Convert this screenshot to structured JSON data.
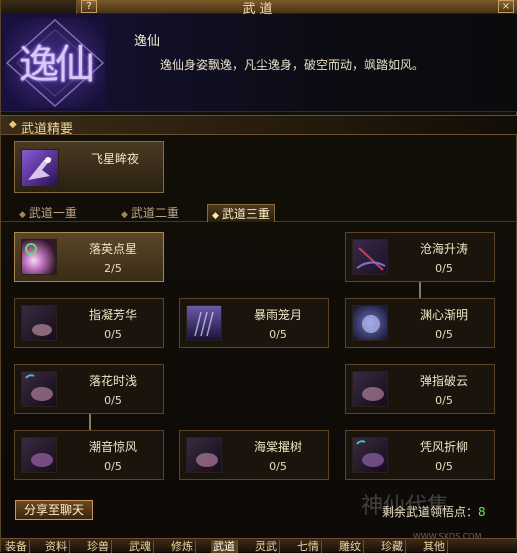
{
  "window": {
    "title": "武道",
    "help_label": "?",
    "close_label": "×"
  },
  "header": {
    "emblem_text": "逸仙",
    "skill_name": "逸仙",
    "skill_description": "逸仙身姿飘逸，凡尘逸身，破空而动，飒踏如风。"
  },
  "essence": {
    "section_label": "武道精要",
    "card": {
      "name": "飞星眸夜"
    }
  },
  "tabs": [
    {
      "label": "武道一重",
      "active": false
    },
    {
      "label": "武道二重",
      "active": false
    },
    {
      "label": "武道三重",
      "active": true
    }
  ],
  "skills": [
    {
      "name": "落英点星",
      "level": "2/5",
      "active": true,
      "icon": "spark-icon"
    },
    {
      "name": "沧海升涛",
      "level": "0/5",
      "active": false,
      "icon": "wave-icon"
    },
    {
      "name": "指凝芳华",
      "level": "0/5",
      "active": false,
      "icon": "blade-icon"
    },
    {
      "name": "暴雨笼月",
      "level": "0/5",
      "active": false,
      "icon": "rain-icon"
    },
    {
      "name": "渊心渐明",
      "level": "0/5",
      "active": false,
      "icon": "moon-icon"
    },
    {
      "name": "落花时浅",
      "level": "0/5",
      "active": false,
      "icon": "petal-icon"
    },
    {
      "name": "弹指破云",
      "level": "0/5",
      "active": false,
      "icon": "flick-icon"
    },
    {
      "name": "潮音惊风",
      "level": "0/5",
      "active": false,
      "icon": "tide-icon"
    },
    {
      "name": "海棠擢树",
      "level": "0/5",
      "active": false,
      "icon": "blossom-icon"
    },
    {
      "name": "凭风折柳",
      "level": "0/5",
      "active": false,
      "icon": "willow-icon"
    }
  ],
  "footer": {
    "share_label": "分享至聊天",
    "remaining_label": "剩余武道领悟点：",
    "remaining_value": "8"
  },
  "watermark": {
    "text": "神仙代售",
    "url": "WWW.SXDS.COM"
  },
  "bottom_tabs": [
    {
      "label": "装备",
      "active": false
    },
    {
      "label": "资料",
      "active": false
    },
    {
      "label": "珍兽",
      "active": false
    },
    {
      "label": "武魂",
      "active": false
    },
    {
      "label": "修炼",
      "active": false
    },
    {
      "label": "武道",
      "active": true
    },
    {
      "label": "灵武",
      "active": false
    },
    {
      "label": "七情",
      "active": false
    },
    {
      "label": "雕纹",
      "active": false
    },
    {
      "label": "珍藏",
      "active": false
    },
    {
      "label": "其他",
      "active": false
    }
  ],
  "colors": {
    "accent": "#c8985a",
    "level_value": "#6ee06e",
    "skill_glow": "#7a4ad8"
  }
}
